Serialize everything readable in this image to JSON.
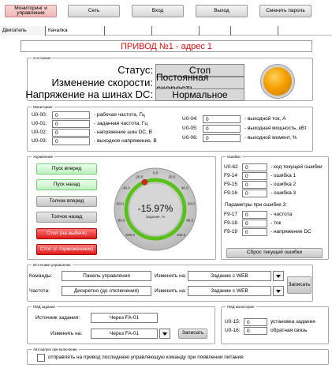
{
  "nav": {
    "monitoring": "Мониторинг и управление",
    "network": "Сеть",
    "login": "Вход",
    "logout": "Выход",
    "change_password": "Сменить пароль"
  },
  "tabs": {
    "engine": "Двигатель",
    "swing": "Качалка"
  },
  "title": "ПРИВОД №1 - адрес 1",
  "state": {
    "legend": "Состояние",
    "status_label": "Статус:",
    "status_value": "Стоп",
    "speed_change_label": "Изменение скорости:",
    "speed_change_value": "Постоянная скорость",
    "dc_bus_label": "Напряжение на шинах DC:",
    "dc_bus_value": "Нормальное",
    "indicator_color": "#f5a000"
  },
  "monitoring": {
    "legend": "Мониторинг",
    "left": [
      {
        "code": "U0-00:",
        "value": "0",
        "desc": "- рабочая частота, Гц"
      },
      {
        "code": "U0-01:",
        "value": "0",
        "desc": "- заданная частота, Гц"
      },
      {
        "code": "U0-02:",
        "value": "0",
        "desc": "- напряжение шин DC, В"
      },
      {
        "code": "U0-03:",
        "value": "0",
        "desc": "- выходное напряжение, В"
      }
    ],
    "right": [
      {
        "code": "U0-04:",
        "value": "0",
        "desc": "- выходной ток, А"
      },
      {
        "code": "U0-05:",
        "value": "0",
        "desc": "- выходная мощность, кВт"
      },
      {
        "code": "U0-06:",
        "value": "0",
        "desc": "- выходной момент, %"
      }
    ]
  },
  "control": {
    "legend": "Управление",
    "start_forward": "Пуск вперед",
    "start_back": "Пуск назад",
    "jog_forward": "Толчок вперед",
    "jog_back": "Толчок назад",
    "stop_coast": "Стоп (на выбеге)",
    "stop_brake": "Стоп (с торможением)"
  },
  "gauge": {
    "value_text": "-15.97%",
    "caption": "Задание, %",
    "value": -15.97,
    "ticks": [
      "-100.0",
      "-80.0",
      "-60.0",
      "-40.0",
      "-20.0",
      "0.0",
      "20.0",
      "40.0",
      "60.0",
      "80.0",
      "100.0"
    ]
  },
  "errors": {
    "legend": "Ошибки",
    "rows": [
      {
        "code": "U0-62",
        "value": "0",
        "desc": "- код текущей ошибки"
      },
      {
        "code": "F9-14",
        "value": "0",
        "desc": "- ошибка 1"
      },
      {
        "code": "F9-15",
        "value": "0",
        "desc": "- ошибка 2"
      },
      {
        "code": "F9-16",
        "value": "0",
        "desc": "- ошибка 3"
      }
    ],
    "params_title": "Параметры при ошибке 3:",
    "params": [
      {
        "code": "F9-17",
        "value": "0",
        "desc": "- частота"
      },
      {
        "code": "F9-18",
        "value": "0",
        "desc": "- ток"
      },
      {
        "code": "F9-19",
        "value": "0",
        "desc": "- напряжение DC"
      }
    ],
    "reset_button": "Сброс текущей ошибки"
  },
  "sources": {
    "legend": "Источники управления",
    "commands_label": "Команды:",
    "commands_value": "Панель управления",
    "change_to_1": "Изменить на:",
    "commands_target": "Задание с WEB",
    "frequency_label": "Частота:",
    "frequency_value": "Дискретно (до отключения)",
    "change_to_2": "Изменить на:",
    "frequency_target": "Задание с WEB",
    "write_button": "Записать"
  },
  "pid": {
    "legend": "ПИД задание",
    "source_label": "Источник задания:",
    "source_value": "Через FA-01",
    "change_label": "Изменить на:",
    "change_value": "Через FA-01",
    "write_button": "Записать"
  },
  "pid_monitoring": {
    "legend": "ПИД мониторинг",
    "rows": [
      {
        "code": "U0-15:",
        "value": "0",
        "desc": "установка задания"
      },
      {
        "code": "U0-16:",
        "value": "0",
        "desc": "обратная связь"
      }
    ]
  },
  "autostart": {
    "legend": "Автозапуск при включении",
    "checkbox_label": "отправлять на привод последнюю управляющую команду при появлении питания"
  }
}
